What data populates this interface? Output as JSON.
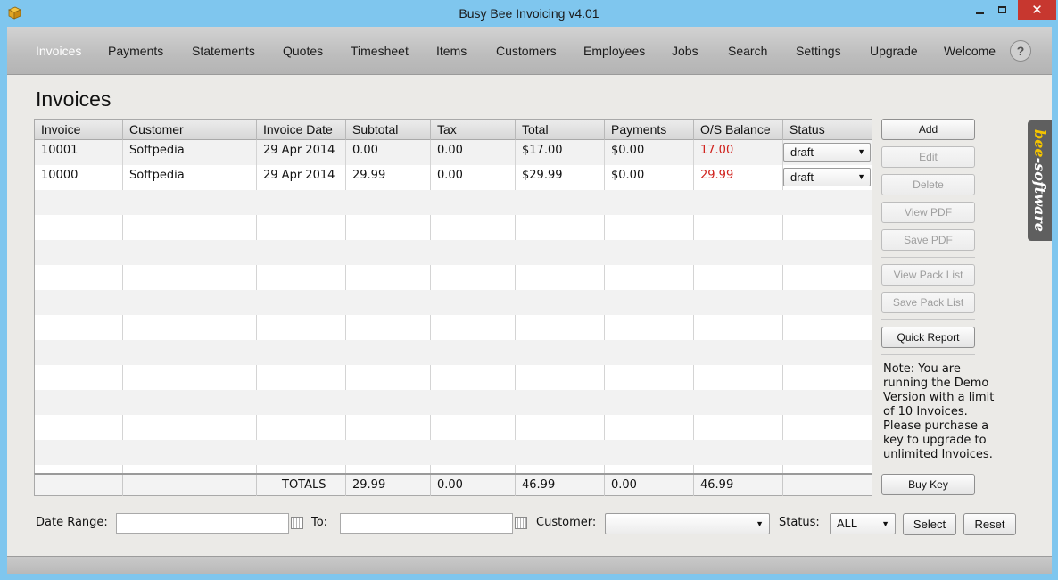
{
  "window": {
    "title": "Busy Bee Invoicing v4.01",
    "minimize": "minimize",
    "maximize": "maximize",
    "close": "✕"
  },
  "nav": {
    "items": [
      "Invoices",
      "Payments",
      "Statements",
      "Quotes",
      "Timesheet",
      "Items",
      "Customers",
      "Employees",
      "Jobs",
      "Search",
      "Settings",
      "Upgrade",
      "Welcome"
    ],
    "active": "Invoices",
    "help": "?"
  },
  "page": {
    "title": "Invoices"
  },
  "table": {
    "columns": [
      "Invoice",
      "Customer",
      "Invoice Date",
      "Subtotal",
      "Tax",
      "Total",
      "Payments",
      "O/S Balance",
      "Status"
    ],
    "rows": [
      {
        "invoice": "10001",
        "customer": "Softpedia",
        "date": "29 Apr 2014",
        "subtotal": "0.00",
        "tax": "0.00",
        "total": "$17.00",
        "payments": "$0.00",
        "balance": "17.00",
        "status": "draft"
      },
      {
        "invoice": "10000",
        "customer": "Softpedia",
        "date": "29 Apr 2014",
        "subtotal": "29.99",
        "tax": "0.00",
        "total": "$29.99",
        "payments": "$0.00",
        "balance": "29.99",
        "status": "draft"
      }
    ],
    "totals": {
      "label": "TOTALS",
      "subtotal": "29.99",
      "tax": "0.00",
      "total": "46.99",
      "payments": "0.00",
      "balance": "46.99"
    }
  },
  "actions": {
    "add": "Add",
    "edit": "Edit",
    "delete": "Delete",
    "view_pdf": "View PDF",
    "save_pdf": "Save PDF",
    "view_pack_list": "View Pack List",
    "save_pack_list": "Save Pack List",
    "quick_report": "Quick Report",
    "buy_key": "Buy Key"
  },
  "note": "Note: You are running the Demo Version with a limit of 10 Invoices.  Please purchase a key to upgrade to unlimited Invoices.",
  "brand": {
    "part1": "bee",
    "part2": "-software"
  },
  "filters": {
    "date_range_label": "Date Range:",
    "date_from": "",
    "to_label": "To:",
    "date_to": "",
    "customer_label": "Customer:",
    "customer_value": "",
    "status_label": "Status:",
    "status_value": "ALL",
    "select_button": "Select",
    "reset_button": "Reset"
  },
  "colors": {
    "accent_red": "#d0201b",
    "titlebar": "#7fc6ee",
    "close": "#c7372f"
  }
}
